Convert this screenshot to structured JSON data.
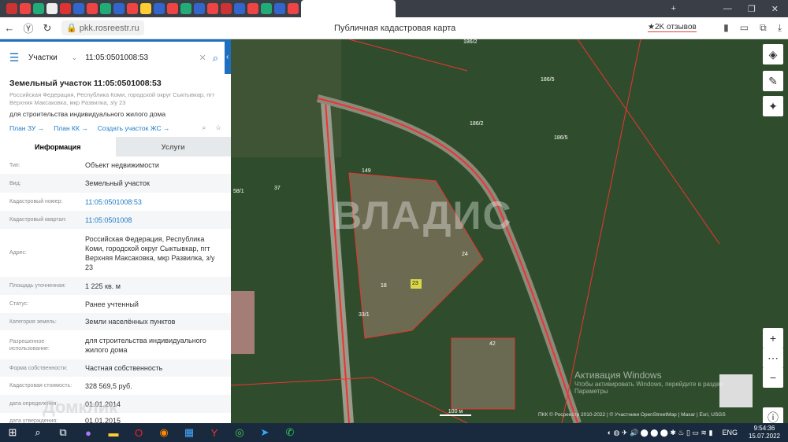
{
  "browser": {
    "url": "pkk.rosreestr.ru",
    "title": "Публичная кадастровая карта",
    "reviews": "★2K отзывов"
  },
  "search": {
    "category": "Участки",
    "query": "11:05:0501008:53"
  },
  "parcel": {
    "title": "Земельный участок 11:05:0501008:53",
    "address_short": "Российская Федерация, Республика Коми, городской округ Сыктывкар, пгт Верхняя Максаковка, мкр Развилка, з/у 23",
    "use": "для строительства индивидуального жилого дома",
    "links": [
      "План ЗУ →",
      "План КК →",
      "Создать участок ЖС →"
    ]
  },
  "tabs": {
    "info": "Информация",
    "services": "Услуги"
  },
  "rows": [
    {
      "label": "Тип:",
      "value": "Объект недвижимости"
    },
    {
      "label": "Вид:",
      "value": "Земельный участок"
    },
    {
      "label": "Кадастровый номер:",
      "value": "11:05:0501008:53"
    },
    {
      "label": "Кадастровый квартал:",
      "value": "11:05:0501008"
    },
    {
      "label": "Адрес:",
      "value": "Российская Федерация, Республика Коми, городской округ Сыктывкар, пгт Верхняя Максаковка, мкр Развилка, з/у 23"
    },
    {
      "label": "Площадь уточненная:",
      "value": "1 225 кв. м"
    },
    {
      "label": "Статус:",
      "value": "Ранее учтенный"
    },
    {
      "label": "Категория земель:",
      "value": "Земли населённых пунктов"
    },
    {
      "label": "Разрешенное использование:",
      "value": "для строительства индивидуального жилого дома"
    },
    {
      "label": "Форма собственности:",
      "value": "Частная собственность"
    },
    {
      "label": "Кадастровая стоимость:",
      "value": "328 569,5 руб."
    },
    {
      "label": "дата определения:",
      "value": "01.01.2014"
    },
    {
      "label": "дата утверждения:",
      "value": "01.01.2015"
    }
  ],
  "map": {
    "labels": [
      "186/2",
      "186/5",
      "186/2",
      "186/5",
      "58/1",
      "37",
      "149",
      "33/1",
      "42",
      "18",
      "23",
      "24"
    ],
    "scale": "100 м",
    "attribution": "ПКК © Росреестр 2010-2022 | © Участники OpenStreetMap | Maxar | Esri, USGS",
    "activation_title": "Активация Windows",
    "activation_text": "Чтобы активировать Windows, перейдите в раздел",
    "activation_text2": "Параметры",
    "watermark": "ВЛАДИС",
    "watermark2": "Домклик"
  },
  "taskbar": {
    "lang": "ENG",
    "time": "9:54:36",
    "date": "15.07.2022"
  }
}
